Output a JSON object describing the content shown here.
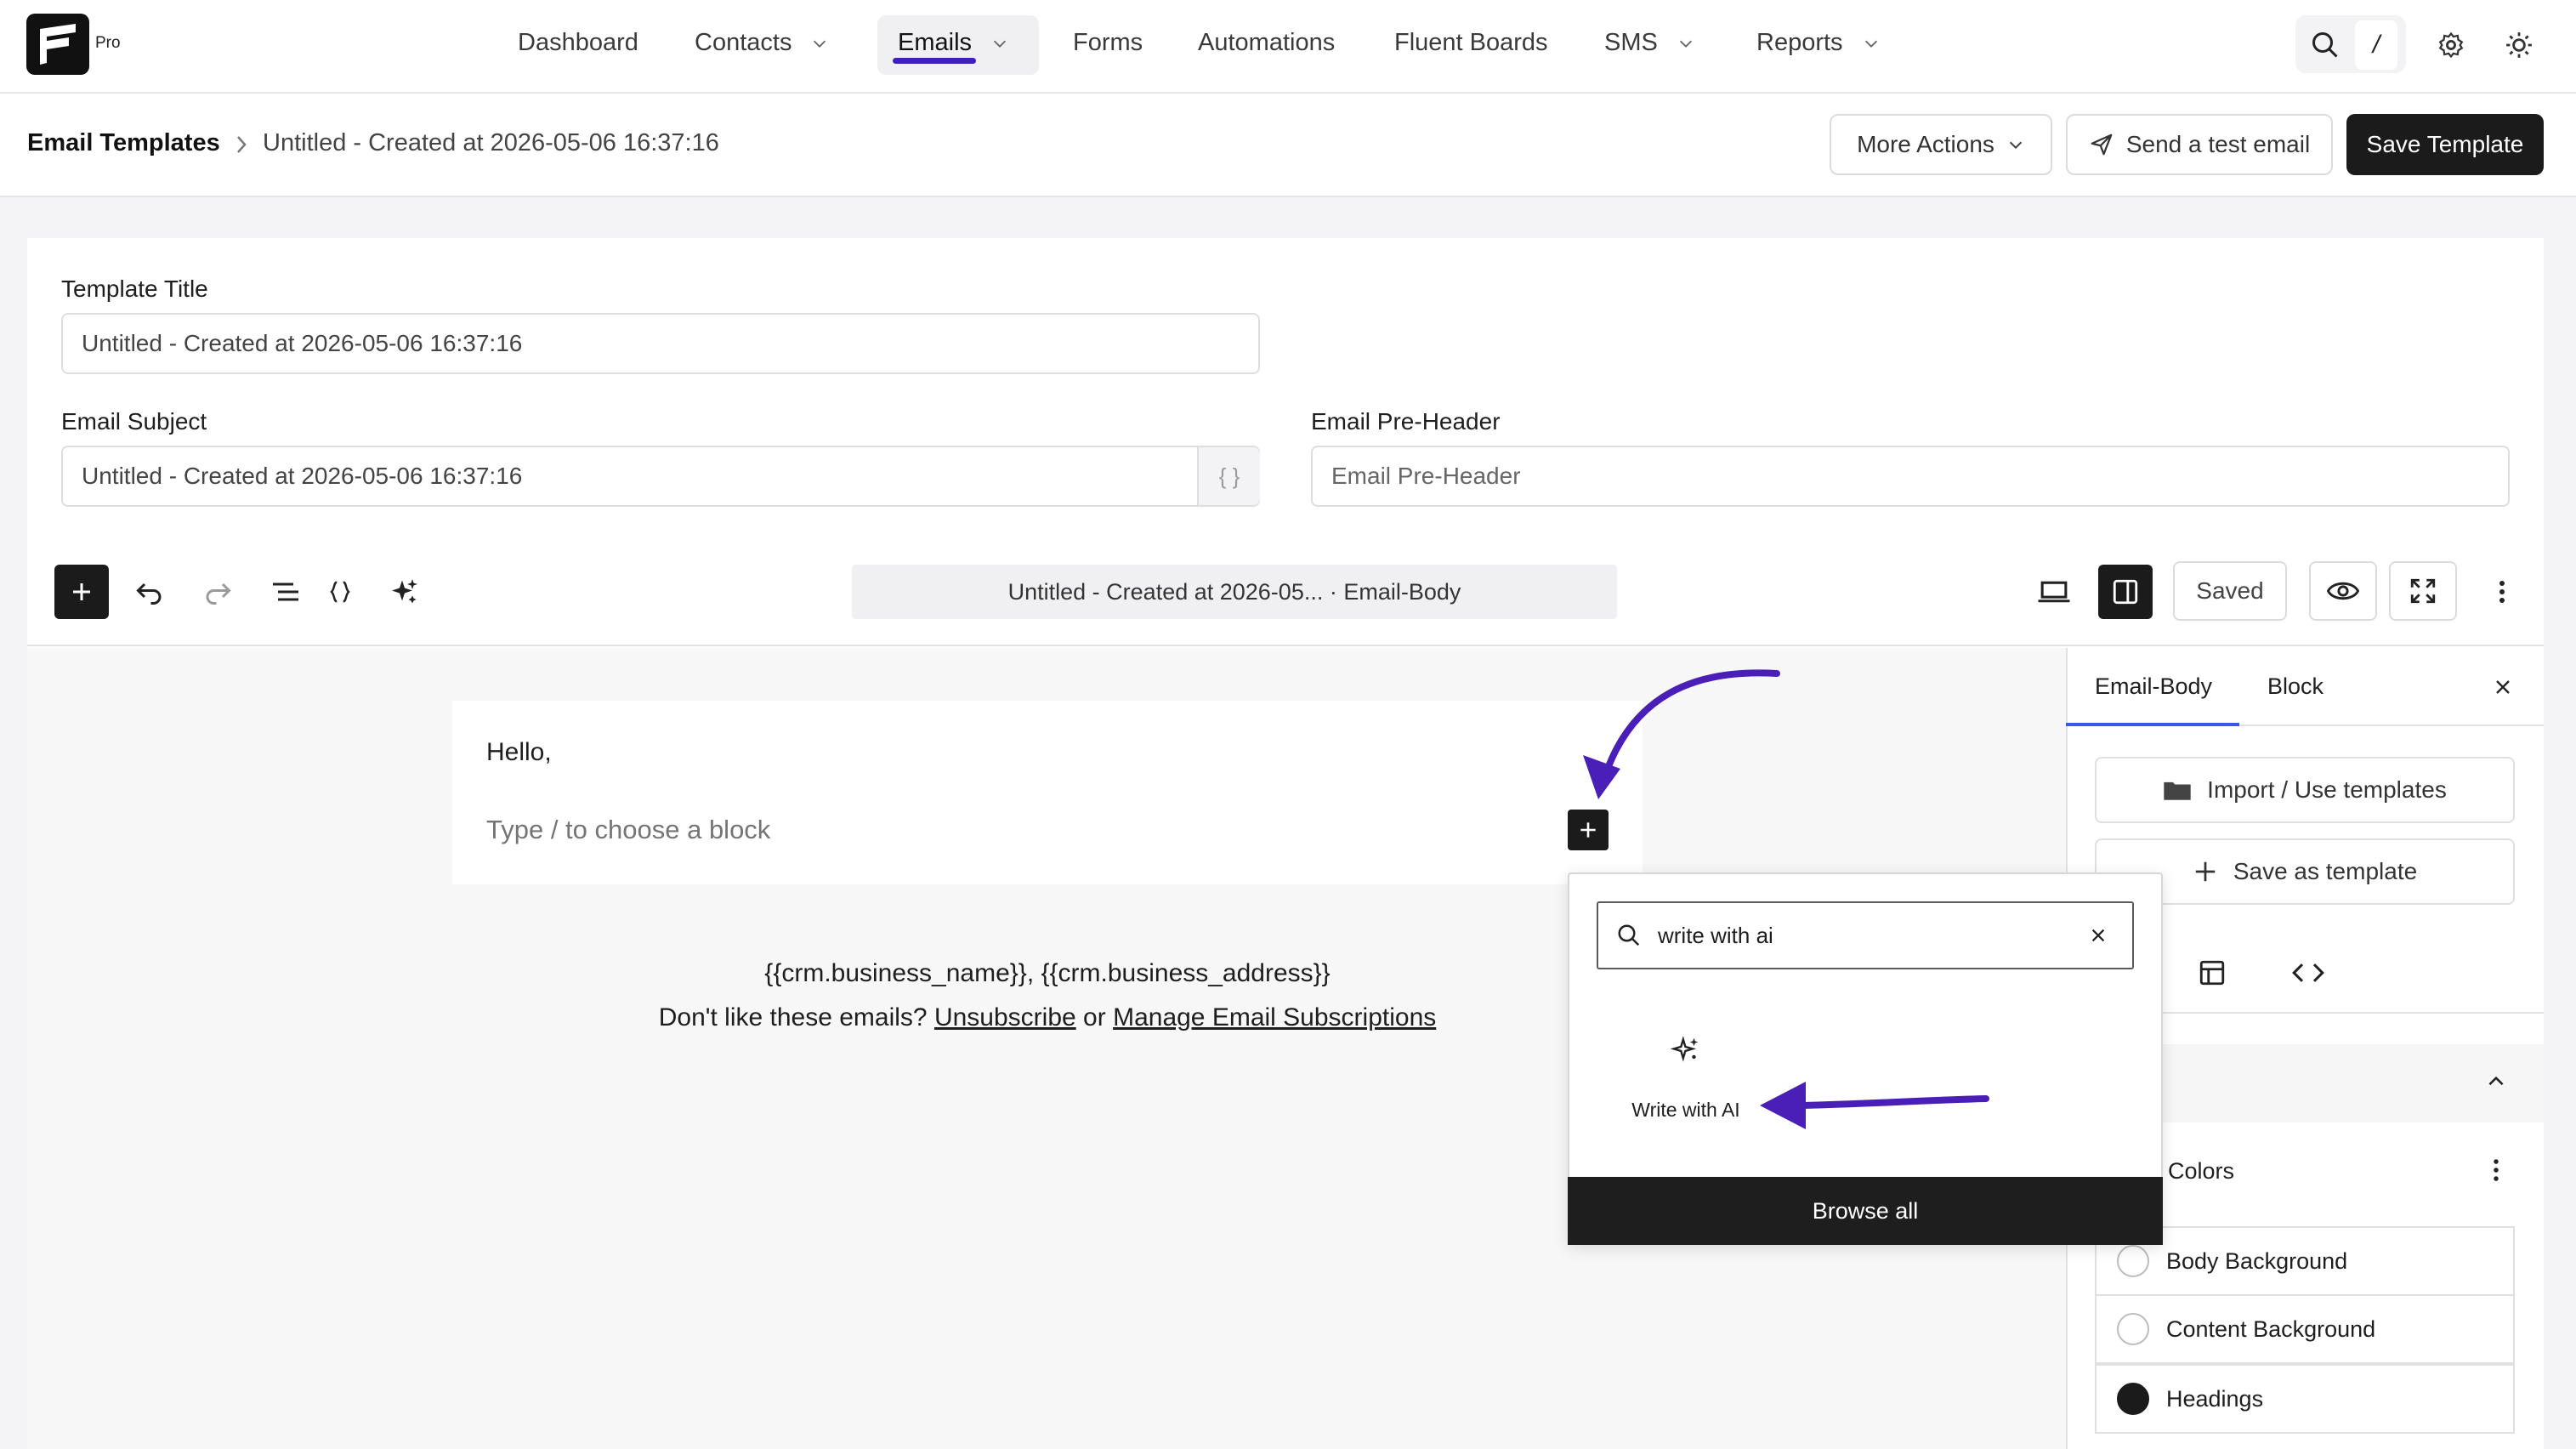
{
  "brand": {
    "badge": "Pro"
  },
  "nav": {
    "items": [
      {
        "label": "Dashboard"
      },
      {
        "label": "Contacts"
      },
      {
        "label": "Emails"
      },
      {
        "label": "Forms"
      },
      {
        "label": "Automations"
      },
      {
        "label": "Fluent Boards"
      },
      {
        "label": "SMS"
      },
      {
        "label": "Reports"
      }
    ],
    "active": "Emails",
    "shortcut_hint": "/"
  },
  "header": {
    "breadcrumb_root": "Email Templates",
    "breadcrumb_current": "Untitled - Created at 2026-05-06 16:37:16",
    "more_actions": "More Actions",
    "send_test": "Send a test email",
    "save_template": "Save Template"
  },
  "form": {
    "template_title_label": "Template Title",
    "template_title_value": "Untitled - Created at 2026-05-06 16:37:16",
    "email_subject_label": "Email Subject",
    "email_subject_value": "Untitled - Created at 2026-05-06 16:37:16",
    "subject_addon": "{ }",
    "pre_header_label": "Email Pre-Header",
    "pre_header_placeholder": "Email Pre-Header"
  },
  "toolbar": {
    "document_title": "Untitled - Created at 2026-05... · Email-Body",
    "saved_label": "Saved"
  },
  "canvas": {
    "greeting": "Hello,",
    "block_hint": "Type / to choose a block",
    "footer_merge_tags": "{{crm.business_name}}, {{crm.business_address}}",
    "footer_prefix": "Don't like these emails?",
    "unsubscribe": "Unsubscribe",
    "footer_or": "or",
    "manage_subscriptions": "Manage Email Subscriptions"
  },
  "inserter": {
    "search_value": "write with ai",
    "result_label": "Write with AI",
    "browse_all": "Browse all"
  },
  "sidebar": {
    "tabs": [
      {
        "label": "Email-Body"
      },
      {
        "label": "Block"
      }
    ],
    "import_templates": "Import / Use templates",
    "save_as_template": "Save as template",
    "colors_label": "Colors",
    "colors": [
      {
        "label": "Body Background",
        "swatch": "#ffffff"
      },
      {
        "label": "Content Background",
        "swatch": "#ffffff"
      },
      {
        "label": "Headings",
        "swatch": "#1b1b1b"
      }
    ]
  },
  "theme": {
    "accent": "#3f1ec2",
    "dark": "#1b1b1b",
    "arrow": "#4a1fb8"
  }
}
